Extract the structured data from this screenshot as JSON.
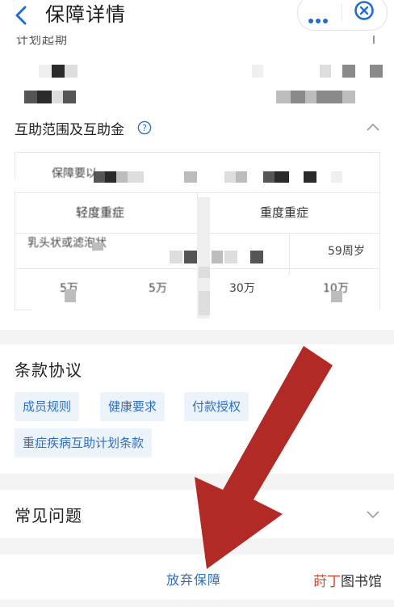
{
  "header": {
    "title": "保障详情"
  },
  "partial_label": "计划起期",
  "section_range": {
    "title": "互助范围及互助金",
    "table": {
      "row1_label": "保障要以",
      "col_mild": "轻度重症",
      "col_severe": "重度重症",
      "row3_label": "乳头状或滤泡状",
      "row3_right": "59周岁",
      "row4": [
        "5万",
        "5万",
        "30万",
        "10万"
      ]
    }
  },
  "terms": {
    "title": "条款协议",
    "tags": [
      "成员规则",
      "健康要求",
      "付款授权",
      "重症疾病互助计划条款"
    ]
  },
  "faq": {
    "title": "常见问题"
  },
  "footer": {
    "abandon_label": "放弃保障"
  },
  "watermark": {
    "part1": "莳丁",
    "part2": "图书馆"
  },
  "colors": {
    "accent_blue": "#2c6fc4",
    "annotation_arrow": "#b22a25",
    "tag_bg": "#edf3fb"
  },
  "icons": [
    "back-chevron-icon",
    "more-dots-icon",
    "close-circle-icon",
    "help-circle-icon",
    "chevron-up-icon",
    "chevron-down-icon",
    "red-annotation-arrow"
  ]
}
